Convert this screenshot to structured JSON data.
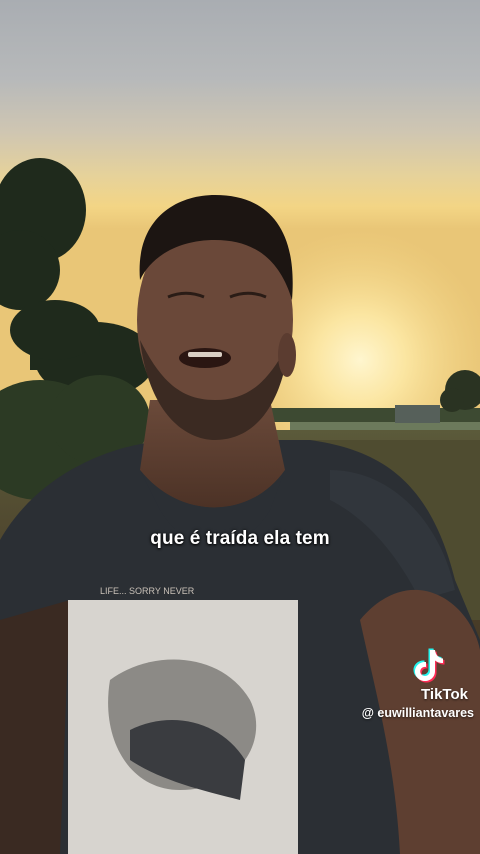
{
  "caption": {
    "text": "que é traída ela tem"
  },
  "watermark": {
    "brand": "TikTok",
    "handle": "@ euwilliantavares",
    "icon": "tiktok-logo-icon"
  },
  "colors": {
    "sky_top": "#aeb2b6",
    "sky_horizon": "#f4d58a",
    "sun": "#fff1b8",
    "caption_text": "#ffffff",
    "tiktok_cyan": "#25f4ee",
    "tiktok_red": "#fe2c55"
  }
}
